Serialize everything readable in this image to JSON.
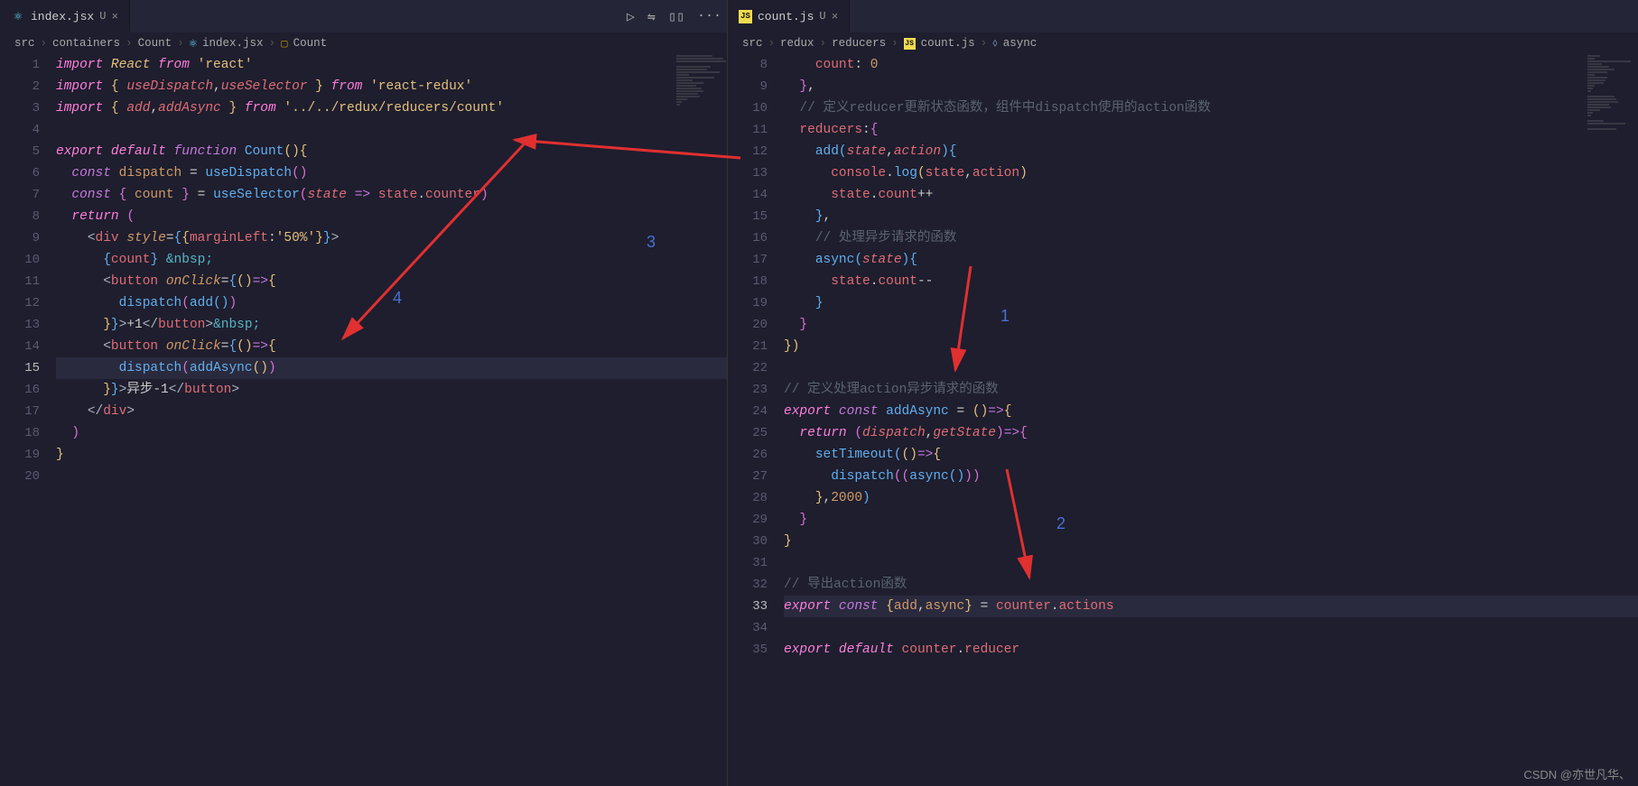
{
  "left": {
    "tab": {
      "icon": "react",
      "label": "index.jsx",
      "modified": "U"
    },
    "tab_actions": [
      "▷",
      "⇋",
      "▯▯",
      "···"
    ],
    "breadcrumb": [
      "src",
      "containers",
      "Count",
      "index.jsx",
      "Count"
    ],
    "lines": [
      {
        "n": 1,
        "html": "<span class='kw2 it'>import</span> <span class='cls it'>React</span> <span class='kw2 it'>from</span> <span class='str'>'react'</span>"
      },
      {
        "n": 2,
        "html": "<span class='kw2 it'>import</span> <span class='brace2'>{</span> <span class='var it'>useDispatch</span><span class='white'>,</span><span class='var it'>useSelector</span> <span class='brace2'>}</span> <span class='kw2 it'>from</span> <span class='str'>'react-redux'</span>"
      },
      {
        "n": 3,
        "html": "<span class='kw2 it'>import</span> <span class='brace2'>{</span> <span class='var it'>add</span><span class='white'>,</span><span class='var it'>addAsync</span> <span class='brace2'>}</span> <span class='kw2 it'>from</span> <span class='str'>'../../redux/reducers/count'</span>"
      },
      {
        "n": 4,
        "html": ""
      },
      {
        "n": 5,
        "html": "<span class='kw2 it'>export</span> <span class='kw2 it'>default</span> <span class='kw it'>function</span> <span class='fn'>Count</span><span class='brace2'>()</span><span class='brace2'>{</span>"
      },
      {
        "n": 6,
        "html": "  <span class='kw it'>const</span> <span class='var2'>dispatch</span> <span class='white'>=</span> <span class='fn'>useDispatch</span><span class='paren'>()</span>"
      },
      {
        "n": 7,
        "html": "  <span class='kw it'>const</span> <span class='paren'>{</span> <span class='var2'>count</span> <span class='paren'>}</span> <span class='white'>=</span> <span class='fn'>useSelector</span><span class='paren'>(</span><span class='var it'>state</span> <span class='kw it'>=></span> <span class='var'>state</span><span class='white'>.</span><span class='var'>counter</span><span class='paren'>)</span>"
      },
      {
        "n": 8,
        "html": "  <span class='kw2 it'>return</span> <span class='paren'>(</span>"
      },
      {
        "n": 9,
        "html": "    <span class='punc'>&lt;</span><span class='tag'>div</span> <span class='attr it'>style</span><span class='white'>=</span><span class='fn'>{</span><span class='brace2'>{</span><span class='var'>marginLeft</span><span class='white'>:</span><span class='str'>'50%'</span><span class='brace2'>}</span><span class='fn'>}</span><span class='punc'>&gt;</span>"
      },
      {
        "n": 10,
        "html": "      <span class='fn'>{</span><span class='var'>count</span><span class='fn'>}</span> <span class='prop'>&amp;nbsp;</span>"
      },
      {
        "n": 11,
        "html": "      <span class='punc'>&lt;</span><span class='tag'>button</span> <span class='attr it'>onClick</span><span class='white'>=</span><span class='fn'>{</span><span class='brace2'>()</span><span class='kw it'>=></span><span class='brace2'>{</span>"
      },
      {
        "n": 12,
        "html": "        <span class='fn'>dispatch</span><span class='paren'>(</span><span class='fn'>add</span><span class='fn'>()</span><span class='paren'>)</span>"
      },
      {
        "n": 13,
        "html": "      <span class='brace2'>}</span><span class='fn'>}</span><span class='punc'>&gt;</span><span class='white'>+1</span><span class='punc'>&lt;/</span><span class='tag'>button</span><span class='punc'>&gt;</span><span class='prop'>&amp;nbsp;</span>"
      },
      {
        "n": 14,
        "html": "      <span class='punc'>&lt;</span><span class='tag'>button</span> <span class='attr it'>onClick</span><span class='white'>=</span><span class='fn'>{</span><span class='brace2'>()</span><span class='kw it'>=></span><span class='brace2'>{</span>"
      },
      {
        "n": 15,
        "hl": true,
        "html": "        <span class='fn'>dispatch</span><span class='paren'>(</span><span class='fn'>addAsync</span><span class='brace2'>()</span><span class='paren'>)</span>"
      },
      {
        "n": 16,
        "html": "      <span class='brace2'>}</span><span class='fn'>}</span><span class='punc'>&gt;</span><span class='white'>异步-1</span><span class='punc'>&lt;/</span><span class='tag'>button</span><span class='punc'>&gt;</span>"
      },
      {
        "n": 17,
        "html": "    <span class='punc'>&lt;/</span><span class='tag'>div</span><span class='punc'>&gt;</span>"
      },
      {
        "n": 18,
        "html": "  <span class='paren'>)</span>"
      },
      {
        "n": 19,
        "html": "<span class='brace2'>}</span>"
      },
      {
        "n": 20,
        "html": ""
      }
    ]
  },
  "right": {
    "tab": {
      "icon": "js",
      "label": "count.js",
      "modified": "U"
    },
    "breadcrumb": [
      "src",
      "redux",
      "reducers",
      "count.js",
      "async"
    ],
    "lines": [
      {
        "n": 8,
        "html": "    <span class='var'>count</span><span class='white'>:</span> <span class='num'>0</span>"
      },
      {
        "n": 9,
        "html": "  <span class='paren'>}</span><span class='white'>,</span>"
      },
      {
        "n": 10,
        "html": "  <span class='cmt'>// 定义reducer更新状态函数，组件中dispatch使用的action函数</span>"
      },
      {
        "n": 11,
        "html": "  <span class='var'>reducers</span><span class='white'>:</span><span class='paren'>{</span>"
      },
      {
        "n": 12,
        "html": "    <span class='fn'>add</span><span class='fn'>(</span><span class='var it'>state</span><span class='white'>,</span><span class='var it'>action</span><span class='fn'>)</span><span class='fn'>{</span>"
      },
      {
        "n": 13,
        "html": "      <span class='var'>console</span><span class='white'>.</span><span class='fn'>log</span><span class='brace2'>(</span><span class='var'>state</span><span class='white'>,</span><span class='var'>action</span><span class='brace2'>)</span>"
      },
      {
        "n": 14,
        "html": "      <span class='var'>state</span><span class='white'>.</span><span class='var'>count</span><span class='white'>++</span>"
      },
      {
        "n": 15,
        "html": "    <span class='fn'>}</span><span class='white'>,</span>"
      },
      {
        "n": 16,
        "html": "    <span class='cmt'>// 处理异步请求的函数</span>"
      },
      {
        "n": 17,
        "html": "    <span class='fn'>async</span><span class='fn'>(</span><span class='var it'>state</span><span class='fn'>)</span><span class='fn'>{</span>"
      },
      {
        "n": 18,
        "html": "      <span class='var'>state</span><span class='white'>.</span><span class='var'>count</span><span class='white'>--</span>"
      },
      {
        "n": 19,
        "html": "    <span class='fn'>}</span>"
      },
      {
        "n": 20,
        "html": "  <span class='paren'>}</span>"
      },
      {
        "n": 21,
        "html": "<span class='brace2'>}</span><span class='brace2'>)</span>"
      },
      {
        "n": 22,
        "html": ""
      },
      {
        "n": 23,
        "html": "<span class='cmt'>// 定义处理action异步请求的函数</span>"
      },
      {
        "n": 24,
        "html": "<span class='kw2 it'>export</span> <span class='kw it'>const</span> <span class='fn'>addAsync</span> <span class='white'>=</span> <span class='brace2'>()</span><span class='kw it'>=></span><span class='brace2'>{</span>"
      },
      {
        "n": 25,
        "html": "  <span class='kw2 it'>return</span> <span class='paren'>(</span><span class='var it'>dispatch</span><span class='white'>,</span><span class='var it'>getState</span><span class='paren'>)</span><span class='kw it'>=></span><span class='paren'>{</span>"
      },
      {
        "n": 26,
        "html": "    <span class='fn'>setTimeout</span><span class='fn'>(</span><span class='brace2'>()</span><span class='kw it'>=></span><span class='brace2'>{</span>"
      },
      {
        "n": 27,
        "html": "      <span class='fn'>dispatch</span><span class='paren'>(</span><span class='paren'>(</span><span class='fn'>async</span><span class='fn'>()</span><span class='paren'>)</span><span class='paren'>)</span>"
      },
      {
        "n": 28,
        "html": "    <span class='brace2'>}</span><span class='white'>,</span><span class='num'>2000</span><span class='fn'>)</span>"
      },
      {
        "n": 29,
        "html": "  <span class='paren'>}</span>"
      },
      {
        "n": 30,
        "html": "<span class='brace2'>}</span>"
      },
      {
        "n": 31,
        "html": ""
      },
      {
        "n": 32,
        "html": "<span class='cmt'>// 导出action函数</span>"
      },
      {
        "n": 33,
        "hl": true,
        "html": "<span class='kw2 it'>export</span> <span class='kw it'>const</span> <span class='brace2'>{</span><span class='var2'>add</span><span class='white'>,</span><span class='var2'>async</span><span class='brace2'>}</span> <span class='white'>=</span> <span class='var'>counter</span><span class='white'>.</span><span class='var'>actions</span>"
      },
      {
        "n": 34,
        "html": ""
      },
      {
        "n": 35,
        "html": "<span class='kw2 it'>export</span> <span class='kw2 it'>default</span> <span class='var'>counter</span><span class='white'>.</span><span class='var'>reducer</span>"
      }
    ]
  },
  "annotations": {
    "nums": [
      "1",
      "2",
      "3",
      "4"
    ]
  },
  "watermark": "CSDN @亦世凡华、"
}
